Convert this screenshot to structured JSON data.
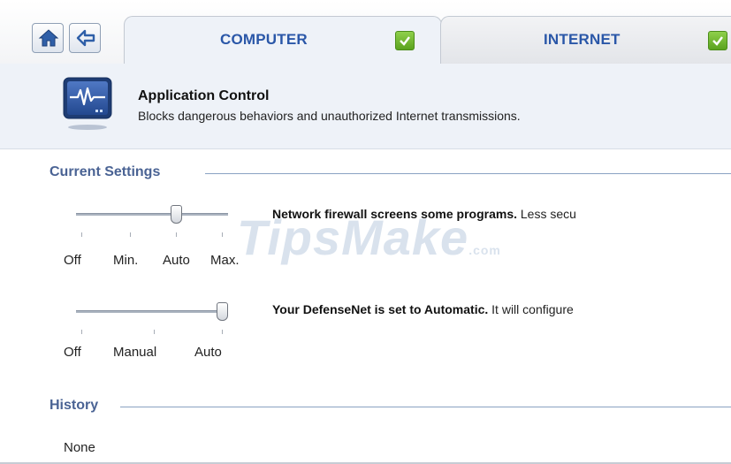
{
  "nav": {
    "home_icon": "home-icon",
    "back_icon": "back-arrow-icon"
  },
  "tabs": [
    {
      "label": "COMPUTER",
      "status_icon": "check-icon",
      "active": true
    },
    {
      "label": "INTERNET",
      "status_icon": "check-icon",
      "active": false
    }
  ],
  "header": {
    "icon": "monitor-pulse-icon",
    "title": "Application Control",
    "description": "Blocks dangerous behaviors and unauthorized Internet transmissions."
  },
  "current_settings": {
    "title": "Current Settings",
    "firewall": {
      "labels": [
        "Off",
        "Min.",
        "Auto",
        "Max."
      ],
      "selected": "Auto",
      "bold_text": "Network firewall screens some programs.",
      "rest_text": " Less secu"
    },
    "defensenet": {
      "labels": [
        "Off",
        "Manual",
        "Auto"
      ],
      "selected": "Auto",
      "bold_text": "Your DefenseNet is set to Automatic.",
      "rest_text": " It will configure"
    }
  },
  "history": {
    "title": "History",
    "value": "None"
  },
  "watermark": {
    "text": "TipsMake",
    "suffix": ".com"
  },
  "colors": {
    "tab_label": "#2a57a8",
    "section_title": "#4a6394",
    "check_green": "#5aa21e",
    "header_band": "#eef2f8"
  }
}
